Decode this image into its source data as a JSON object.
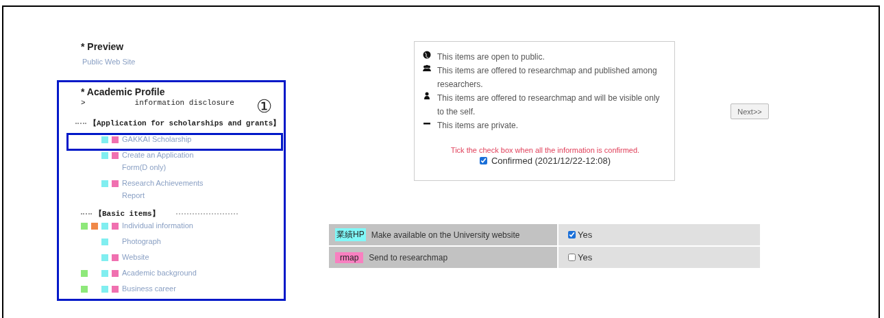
{
  "preview": {
    "heading": "* Preview",
    "link": "Public Web Site"
  },
  "profile": {
    "heading": "* Academic Profile",
    "toggle": ">",
    "subtitle": "information disclosure",
    "marker": "①",
    "sections": [
      {
        "title": "【Application for scholarships and grants】",
        "items": [
          {
            "label": "GAKKAI Scholarship",
            "highlighted": true,
            "tags": [
              {
                "kind": "self",
                "color": "#80eef0"
              },
              {
                "kind": "private",
                "color": "#f070b0"
              }
            ]
          },
          {
            "label": "Create an Application Form(D only)",
            "highlighted": false,
            "tags": [
              {
                "kind": "self",
                "color": "#80eef0"
              },
              {
                "kind": "private",
                "color": "#f070b0"
              }
            ]
          },
          {
            "label": "Research Achievements Report",
            "highlighted": false,
            "tags": [
              {
                "kind": "self",
                "color": "#80eef0"
              },
              {
                "kind": "private",
                "color": "#f070b0"
              }
            ]
          }
        ]
      },
      {
        "title": "【Basic items】",
        "items": [
          {
            "label": "Individual information",
            "highlighted": false,
            "tags": [
              {
                "kind": "public",
                "color": "#8ee87a"
              },
              {
                "kind": "researchers",
                "color": "#f08848"
              },
              {
                "kind": "self",
                "color": "#80eef0"
              },
              {
                "kind": "private",
                "color": "#f070b0"
              }
            ]
          },
          {
            "label": "Photograph",
            "highlighted": false,
            "tags": [
              {
                "kind": "self",
                "color": "#80eef0"
              }
            ]
          },
          {
            "label": "Website",
            "highlighted": false,
            "tags": [
              {
                "kind": "self",
                "color": "#80eef0"
              },
              {
                "kind": "private",
                "color": "#f070b0"
              }
            ]
          },
          {
            "label": "Academic background",
            "highlighted": false,
            "tags": [
              {
                "kind": "public",
                "color": "#8ee87a"
              },
              {
                "kind": "self",
                "color": "#80eef0"
              },
              {
                "kind": "private",
                "color": "#f070b0"
              }
            ]
          },
          {
            "label": "Business career",
            "highlighted": false,
            "tags": [
              {
                "kind": "public",
                "color": "#8ee87a"
              },
              {
                "kind": "self",
                "color": "#80eef0"
              },
              {
                "kind": "private",
                "color": "#f070b0"
              }
            ]
          }
        ]
      }
    ]
  },
  "legend": {
    "items": [
      {
        "kind": "globe",
        "text": "This items are open to public."
      },
      {
        "kind": "group",
        "text": "This items are offered to researchmap and published among researchers."
      },
      {
        "kind": "person",
        "text": "This items are offered to researchmap and will be visible only to the self."
      },
      {
        "kind": "minus",
        "text": "This items are private."
      }
    ],
    "notice": "Tick the check box when all the information is confirmed.",
    "confirm": {
      "checked": true,
      "label": "Confirmed (2021/12/22-12:08)"
    }
  },
  "next_button": "Next>>",
  "options": [
    {
      "tag": "業績HP",
      "color": "#80f8f8",
      "label": "Make available on the University website",
      "checked": true,
      "option": "Yes"
    },
    {
      "tag": "rmap",
      "color": "#f880c0",
      "label": "Send to researchmap",
      "checked": false,
      "option": "Yes"
    }
  ]
}
